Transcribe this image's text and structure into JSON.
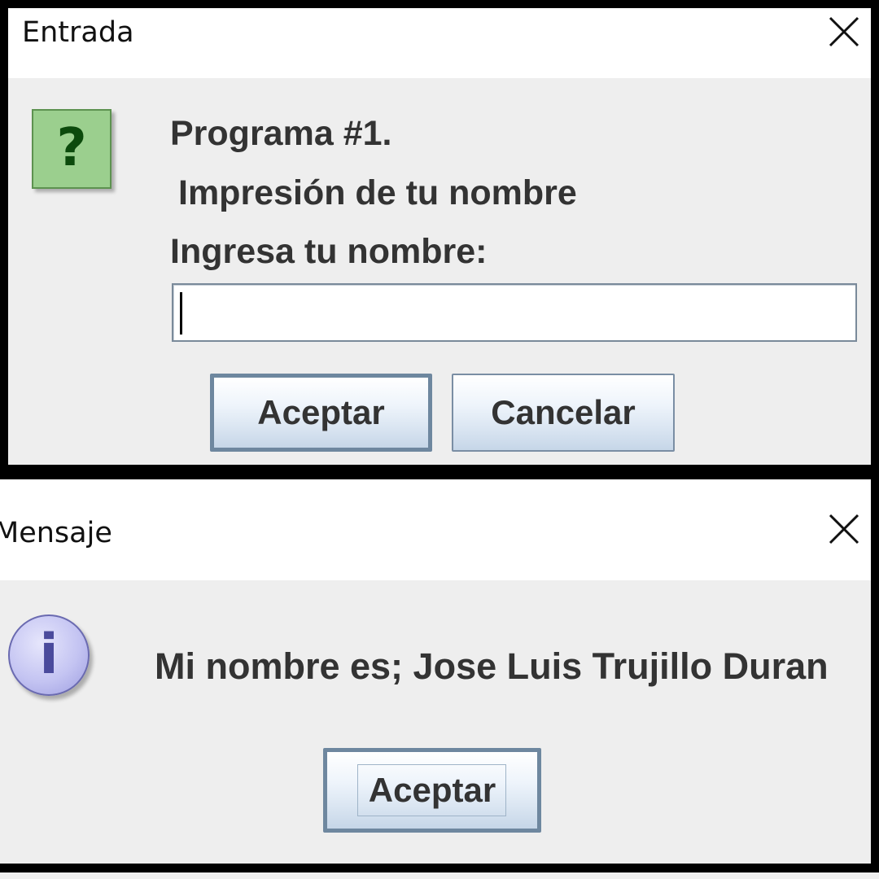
{
  "input_dialog": {
    "title": "Entrada",
    "close_glyph": "×",
    "icon": "question-icon",
    "icon_glyph": "?",
    "lines": [
      "Programa #1.",
      "Impresión de tu nombre",
      "Ingresa tu nombre:"
    ],
    "name_input": {
      "value": "",
      "placeholder": ""
    },
    "ok_label": "Aceptar",
    "cancel_label": "Cancelar"
  },
  "message_dialog": {
    "title": "Mensaje",
    "close_glyph": "×",
    "icon": "information-icon",
    "icon_glyph": "i",
    "message": "Mi nombre es; Jose Luis Trujillo Duran",
    "ok_label": "Aceptar"
  },
  "colors": {
    "dialog_bg": "#eeeeee",
    "titlebar_bg": "#ffffff",
    "text": "#333333",
    "question_icon_fill": "#9bcf8e",
    "info_icon_fill": "#c4c4f2",
    "button_border": "#7a8ea4"
  }
}
